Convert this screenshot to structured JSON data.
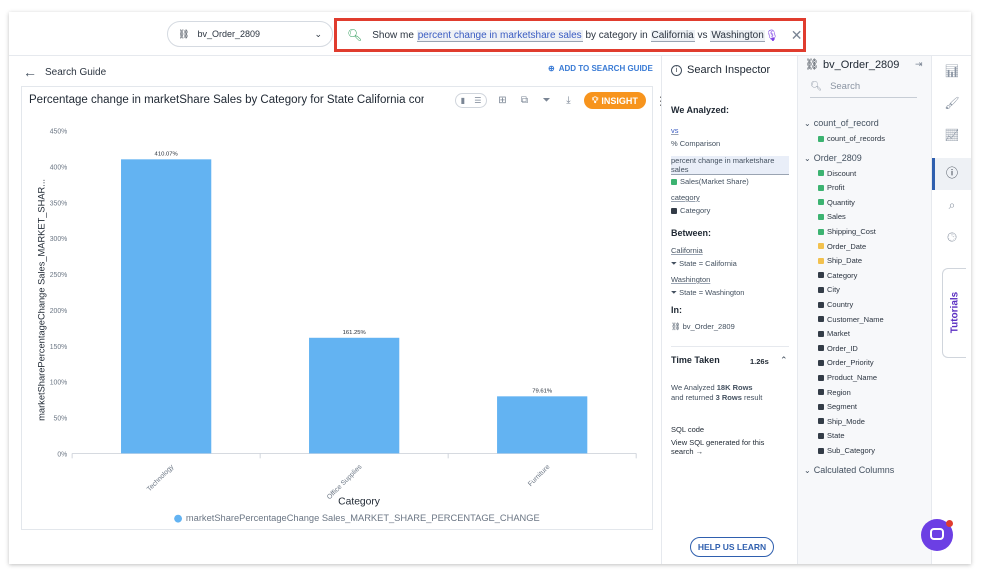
{
  "topbar": {
    "datasource": "bv_Order_2809",
    "search_prefix": "Show me",
    "search_tokens": [
      {
        "text": "percent change in marketshare sales",
        "style": "token"
      },
      {
        "text": " by category in ",
        "style": "plain"
      },
      {
        "text": "California",
        "style": "token"
      },
      {
        "text": " vs ",
        "style": "plain"
      },
      {
        "text": "Washington",
        "style": "token"
      }
    ]
  },
  "guide": {
    "back_label": "Search Guide",
    "add_label": "ADD TO SEARCH GUIDE"
  },
  "card": {
    "title": "Percentage change in marketShare Sales by Category for State California comp...",
    "insight_label": "INSIGHT"
  },
  "chart_data": {
    "type": "bar",
    "categories": [
      "Technology",
      "Office Supplies",
      "Furniture"
    ],
    "values": [
      410.07,
      161.25,
      79.61
    ],
    "data_labels": [
      "410.07%",
      "161.25%",
      "79.61%"
    ],
    "xlabel": "Category",
    "ylabel": "marketSharePercentageChange Sales_MARKET_SHAR...",
    "ylim": [
      0,
      450
    ],
    "yticks": [
      "0%",
      "50%",
      "100%",
      "150%",
      "200%",
      "250%",
      "300%",
      "350%",
      "400%",
      "450%"
    ],
    "legend": "marketSharePercentageChange Sales_MARKET_SHARE_PERCENTAGE_CHANGE",
    "color": "#63b3f2"
  },
  "inspector": {
    "title": "Search Inspector",
    "analyzed_header": "We Analyzed:",
    "vs_token": "vs",
    "vs_desc": "Comparison",
    "pct_token": "percent change in marketshare sales",
    "pct_desc": "Sales(Market Share)",
    "cat_token": "category",
    "cat_desc": "Category",
    "between_header": "Between:",
    "b1_token": "California",
    "b1_desc": "State = California",
    "b2_token": "Washington",
    "b2_desc": "State = Washington",
    "in_header": "In:",
    "in_desc": "bv_Order_2809",
    "time_header": "Time Taken",
    "time_value": "1.26s",
    "analyzed_prefix": "We Analyzed",
    "rows_count": "18K Rows",
    "returned_prefix": "and returned",
    "returned_count": "3 Rows",
    "returned_suffix": "result",
    "sql_header": "SQL code",
    "sql_link": "View SQL generated for this search",
    "help_label": "HELP US LEARN"
  },
  "columns_panel": {
    "title": "bv_Order_2809",
    "search_placeholder": "Search",
    "groups": [
      {
        "name": "count_of_record",
        "columns": [
          {
            "name": "count_of_records",
            "kind": "measure"
          }
        ]
      },
      {
        "name": "Order_2809",
        "columns": [
          {
            "name": "Discount",
            "kind": "measure"
          },
          {
            "name": "Profit",
            "kind": "measure"
          },
          {
            "name": "Quantity",
            "kind": "measure"
          },
          {
            "name": "Sales",
            "kind": "measure"
          },
          {
            "name": "Shipping_Cost",
            "kind": "measure"
          },
          {
            "name": "Order_Date",
            "kind": "date"
          },
          {
            "name": "Ship_Date",
            "kind": "date"
          },
          {
            "name": "Category",
            "kind": "attribute"
          },
          {
            "name": "City",
            "kind": "attribute"
          },
          {
            "name": "Country",
            "kind": "attribute"
          },
          {
            "name": "Customer_Name",
            "kind": "attribute"
          },
          {
            "name": "Market",
            "kind": "attribute"
          },
          {
            "name": "Order_ID",
            "kind": "attribute"
          },
          {
            "name": "Order_Priority",
            "kind": "attribute"
          },
          {
            "name": "Product_Name",
            "kind": "attribute"
          },
          {
            "name": "Region",
            "kind": "attribute"
          },
          {
            "name": "Segment",
            "kind": "attribute"
          },
          {
            "name": "Ship_Mode",
            "kind": "attribute"
          },
          {
            "name": "State",
            "kind": "attribute"
          },
          {
            "name": "Sub_Category",
            "kind": "attribute"
          }
        ]
      },
      {
        "name": "Calculated Columns",
        "columns": []
      }
    ]
  },
  "rail": {
    "tutorials_label": "Tutorials"
  }
}
